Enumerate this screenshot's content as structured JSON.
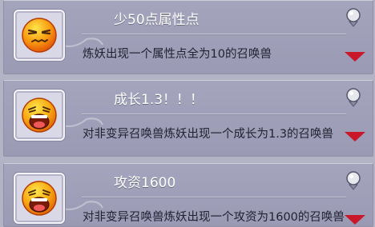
{
  "items": [
    {
      "title": "少50点属性点",
      "description": "炼妖出现一个属性点全为10的召唤兽",
      "icon": "sleepy-face-icon"
    },
    {
      "title": "成长1.3！！！",
      "description": "对非变异召唤兽炼妖出现一个成长为1.3的召唤兽",
      "icon": "laughing-face-icon"
    },
    {
      "title": "攻资1600",
      "description": "对非变异召唤兽炼妖出现一个攻资为1600的召唤兽",
      "icon": "laughing-face-icon"
    }
  ],
  "colors": {
    "accent_arrow": "#c8182a",
    "title_text": "#ffffff",
    "desc_text": "#222233"
  }
}
